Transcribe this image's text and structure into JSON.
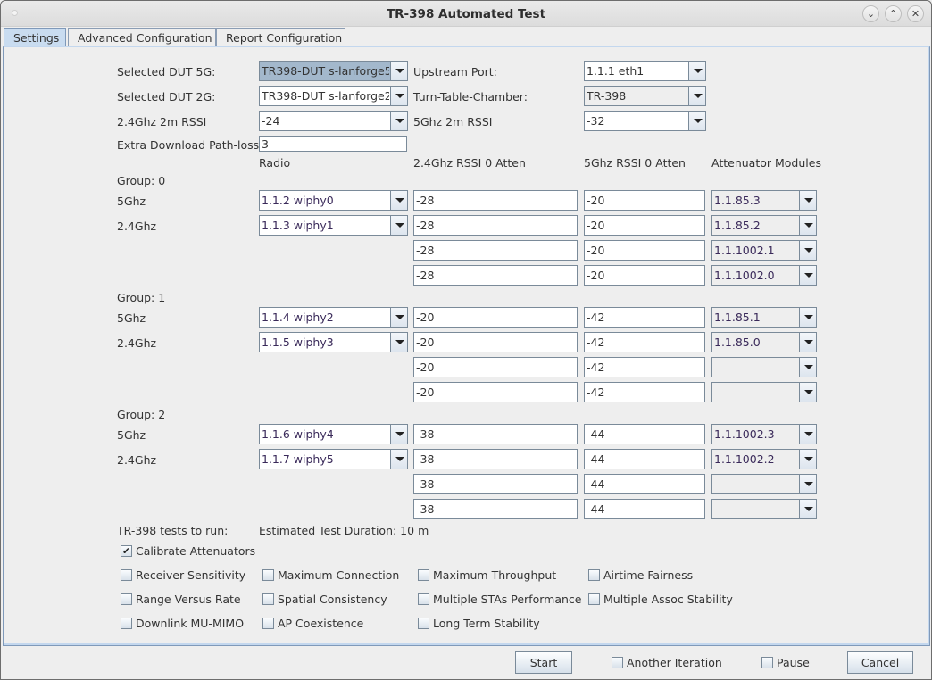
{
  "window": {
    "title": "TR-398 Automated Test",
    "controls": [
      "minimize",
      "maximize",
      "close"
    ]
  },
  "tabs": [
    {
      "label": "Settings",
      "active": true
    },
    {
      "label": "Advanced Configuration",
      "active": false
    },
    {
      "label": "Report Configuration",
      "active": false
    }
  ],
  "settings": {
    "dut5g": {
      "label": "Selected DUT 5G:",
      "value": "TR398-DUT s-lanforge5"
    },
    "dut2g": {
      "label": "Selected DUT 2G:",
      "value": "TR398-DUT s-lanforge2"
    },
    "rssi24": {
      "label": "2.4Ghz 2m RSSI",
      "value": "-24"
    },
    "pathloss": {
      "label": "Extra Download Path-loss",
      "value": "3"
    },
    "upstream": {
      "label": "Upstream Port:",
      "value": "1.1.1 eth1"
    },
    "chamber": {
      "label": "Turn-Table-Chamber:",
      "value": "TR-398"
    },
    "rssi5": {
      "label": "5Ghz 2m RSSI",
      "value": "-32"
    }
  },
  "columns": {
    "radio": "Radio",
    "rssi24": "2.4Ghz RSSI 0 Atten",
    "rssi5": "5Ghz RSSI 0 Atten",
    "atten": "Attenuator Modules"
  },
  "groups": [
    {
      "label": "Group: 0",
      "rows": [
        {
          "band": "5Ghz",
          "radio": "1.1.2 wiphy0",
          "rssi24": "-28",
          "rssi5": "-20",
          "atten": "1.1.85.3"
        },
        {
          "band": "2.4Ghz",
          "radio": "1.1.3 wiphy1",
          "rssi24": "-28",
          "rssi5": "-20",
          "atten": "1.1.85.2"
        },
        {
          "band": "",
          "radio": null,
          "rssi24": "-28",
          "rssi5": "-20",
          "atten": "1.1.1002.1"
        },
        {
          "band": "",
          "radio": null,
          "rssi24": "-28",
          "rssi5": "-20",
          "atten": "1.1.1002.0"
        }
      ]
    },
    {
      "label": "Group: 1",
      "rows": [
        {
          "band": "5Ghz",
          "radio": "1.1.4 wiphy2",
          "rssi24": "-20",
          "rssi5": "-42",
          "atten": "1.1.85.1"
        },
        {
          "band": "2.4Ghz",
          "radio": "1.1.5 wiphy3",
          "rssi24": "-20",
          "rssi5": "-42",
          "atten": "1.1.85.0"
        },
        {
          "band": "",
          "radio": null,
          "rssi24": "-20",
          "rssi5": "-42",
          "atten": ""
        },
        {
          "band": "",
          "radio": null,
          "rssi24": "-20",
          "rssi5": "-42",
          "atten": ""
        }
      ]
    },
    {
      "label": "Group: 2",
      "rows": [
        {
          "band": "5Ghz",
          "radio": "1.1.6 wiphy4",
          "rssi24": "-38",
          "rssi5": "-44",
          "atten": "1.1.1002.3"
        },
        {
          "band": "2.4Ghz",
          "radio": "1.1.7 wiphy5",
          "rssi24": "-38",
          "rssi5": "-44",
          "atten": "1.1.1002.2"
        },
        {
          "band": "",
          "radio": null,
          "rssi24": "-38",
          "rssi5": "-44",
          "atten": ""
        },
        {
          "band": "",
          "radio": null,
          "rssi24": "-38",
          "rssi5": "-44",
          "atten": ""
        }
      ]
    }
  ],
  "tests": {
    "label": "TR-398 tests to run:",
    "duration": "Estimated Test Duration: 10 m",
    "calibrate": {
      "label": "Calibrate Attenuators",
      "checked": true
    },
    "grid": [
      [
        {
          "label": "Receiver Sensitivity",
          "checked": false
        },
        {
          "label": "Maximum Connection",
          "checked": false
        },
        {
          "label": "Maximum Throughput",
          "checked": false
        },
        {
          "label": "Airtime Fairness",
          "checked": false
        }
      ],
      [
        {
          "label": "Range Versus Rate",
          "checked": false
        },
        {
          "label": "Spatial Consistency",
          "checked": false
        },
        {
          "label": "Multiple STAs Performance",
          "checked": false
        },
        {
          "label": "Multiple Assoc Stability",
          "checked": false
        }
      ],
      [
        {
          "label": "Downlink MU-MIMO",
          "checked": false
        },
        {
          "label": "AP Coexistence",
          "checked": false
        },
        {
          "label": "Long Term Stability",
          "checked": false
        }
      ]
    ]
  },
  "footer": {
    "start": {
      "mnemonic": "S",
      "rest": "tart"
    },
    "another_iteration": {
      "label": "Another Iteration",
      "checked": false
    },
    "pause": {
      "label": "Pause",
      "checked": false
    },
    "cancel": {
      "mnemonic": "C",
      "rest": "ancel"
    }
  }
}
